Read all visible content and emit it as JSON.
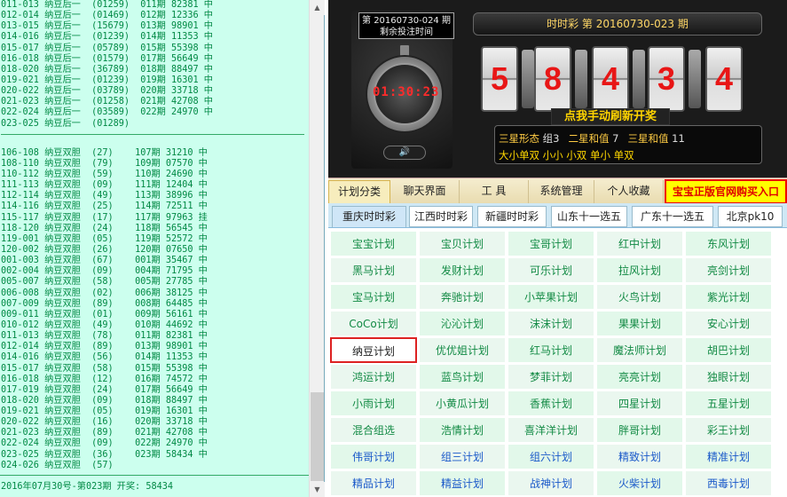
{
  "log": {
    "top_lines": [
      "011-013 纳豆后一  (01259)  011期 82381 中",
      "012-014 纳豆后一  (01469)  012期 12336 中",
      "013-015 纳豆后一  (15679)  013期 98901 中",
      "014-016 纳豆后一  (01239)  014期 11353 中",
      "015-017 纳豆后一  (05789)  015期 55398 中",
      "016-018 纳豆后一  (01579)  017期 56649 中",
      "018-020 纳豆后一  (36789)  018期 88497 中",
      "019-021 纳豆后一  (01239)  019期 16301 中",
      "020-022 纳豆后一  (03789)  020期 33718 中",
      "021-023 纳豆后一  (01258)  021期 42708 中",
      "022-024 纳豆后一  (03589)  022期 24970 中",
      "023-025 纳豆后一  (01289)"
    ],
    "bottom_lines": [
      "106-108 纳豆双胆  (27)    107期 31210 中",
      "108-110 纳豆双胆  (79)    109期 07570 中",
      "110-112 纳豆双胆  (59)    110期 24690 中",
      "111-113 纳豆双胆  (09)    111期 12404 中",
      "112-114 纳豆双胆  (49)    113期 38996 中",
      "114-116 纳豆双胆  (25)    114期 72511 中",
      "115-117 纳豆双胆  (17)    117期 97963 挂",
      "118-120 纳豆双胆  (24)    118期 56545 中",
      "119-001 纳豆双胆  (05)    119期 52572 中",
      "120-002 纳豆双胆  (26)    120期 07650 中",
      "001-003 纳豆双胆  (67)    001期 35467 中",
      "002-004 纳豆双胆  (09)    004期 71795 中",
      "005-007 纳豆双胆  (58)    005期 27785 中",
      "006-008 纳豆双胆  (02)    006期 38125 中",
      "007-009 纳豆双胆  (89)    008期 64485 中",
      "009-011 纳豆双胆  (01)    009期 56161 中",
      "010-012 纳豆双胆  (49)    010期 44692 中",
      "011-013 纳豆双胆  (78)    011期 82381 中",
      "012-014 纳豆双胆  (89)    013期 98901 中",
      "014-016 纳豆双胆  (56)    014期 11353 中",
      "015-017 纳豆双胆  (58)    015期 55398 中",
      "016-018 纳豆双胆  (12)    016期 74572 中",
      "017-019 纳豆双胆  (24)    017期 56649 中",
      "018-020 纳豆双胆  (09)    018期 88497 中",
      "019-021 纳豆双胆  (05)    019期 16301 中",
      "020-022 纳豆双胆  (16)    020期 33718 中",
      "021-023 纳豆双胆  (89)    021期 42708 中",
      "022-024 纳豆双胆  (09)    022期 24970 中",
      "023-025 纳豆双胆  (36)    023期 58434 中",
      "024-026 纳豆双胆  (57)"
    ],
    "footer": "2016年07月30号-第023期  开奖: 58434"
  },
  "scroll": {
    "up": "▲",
    "down": "▼"
  },
  "lottery": {
    "next_label_line1": "第 20160730-024 期",
    "next_label_line2": "剩余投注时间",
    "countdown": "01:30:23",
    "sound_icon": "🔊",
    "current_label": "时时彩    第  20160730-023  期",
    "digits": [
      "5",
      "8",
      "4",
      "3",
      "4"
    ],
    "refresh_label": "点我手动刷新开奖",
    "stats_row1": [
      {
        "label": "三星形态",
        "value": "组3"
      },
      {
        "label": "二星和值",
        "value": "7"
      },
      {
        "label": "三星和值",
        "value": "11"
      }
    ],
    "stats_row2": "大小单双  小小  小双  单小  单双"
  },
  "top_tabs": [
    "计划分类",
    "聊天界面",
    "工    具",
    "系统管理",
    "个人收藏"
  ],
  "buy_button": "宝宝正版官网购买入口",
  "sub_tabs": [
    "重庆时时彩",
    "江西时时彩",
    "新疆时时彩",
    "山东十一选五",
    "广东十一选五",
    "北京pk10"
  ],
  "grid": [
    [
      "宝宝计划",
      "宝贝计划",
      "宝哥计划",
      "红中计划",
      "东风计划"
    ],
    [
      "黑马计划",
      "发财计划",
      "可乐计划",
      "拉风计划",
      "亮剑计划"
    ],
    [
      "宝马计划",
      "奔驰计划",
      "小苹果计划",
      "火鸟计划",
      "紫光计划"
    ],
    [
      "CoCo计划",
      "沁沁计划",
      "沫沫计划",
      "果果计划",
      "安心计划"
    ],
    [
      "纳豆计划",
      "优优姐计划",
      "红马计划",
      "魔法师计划",
      "胡巴计划"
    ],
    [
      "鸿运计划",
      "蓝鸟计划",
      "梦菲计划",
      "亮亮计划",
      "独眼计划"
    ],
    [
      "小雨计划",
      "小黄瓜计划",
      "香蕉计划",
      "四星计划",
      "五星计划"
    ],
    [
      "混合组选",
      "浩情计划",
      "喜洋洋计划",
      "胖哥计划",
      "彩王计划"
    ],
    [
      "伟哥计划",
      "组三计划",
      "组六计划",
      "精致计划",
      "精准计划"
    ],
    [
      "精品计划",
      "精益计划",
      "战神计划",
      "火柴计划",
      "西毒计划"
    ]
  ],
  "colors": {
    "accent_green": "#128a44",
    "selected_border": "#dd2222",
    "buy_text": "#e00000"
  }
}
